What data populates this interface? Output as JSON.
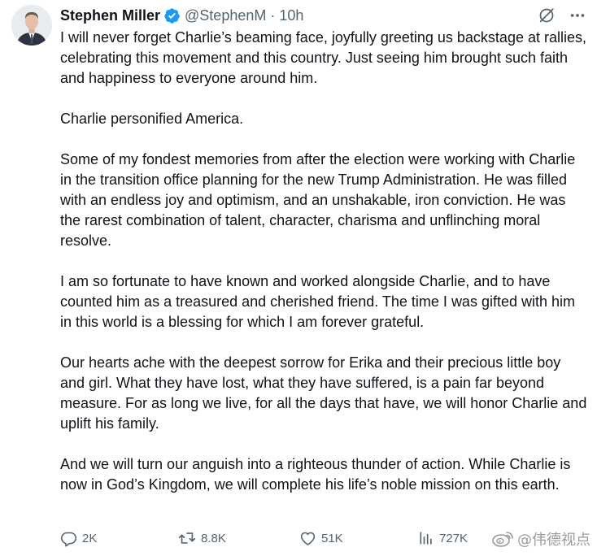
{
  "author": {
    "display_name": "Stephen Miller",
    "handle": "@StephenM",
    "separator": "·",
    "timestamp": "10h",
    "verified": true,
    "verified_color": "#1d9bf0"
  },
  "top_actions": {
    "grok_icon": "grok-icon",
    "more_icon": "more-horizontal-icon"
  },
  "paragraphs": [
    "I will never forget Charlie’s beaming face, joyfully greeting us backstage at rallies, celebrating this movement and this country. Just seeing him brought such faith and happiness to everyone around him.",
    "Charlie personified America.",
    "Some of my fondest memories from after the election were working with Charlie in the transition office planning for the new Trump Administration. He was filled with an endless joy and optimism, and an unshakable, iron conviction. He was the rarest combination of talent, character, charisma and unflinching moral resolve.",
    "I am so fortunate to have known and worked alongside Charlie, and to have counted him as a treasured and cherished friend. The time I was gifted with him in this world is a blessing for which I am forever grateful.",
    "Our hearts ache with the deepest sorrow for Erika and their precious little boy and girl. What they have lost, what they have suffered, is a pain far beyond measure. For as long we live, for all the days that have, we will honor Charlie and uplift his family.",
    "And we will turn our anguish into a righteous thunder of action. While Charlie is now in God’s Kingdom, we will complete his life’s noble mission on this earth."
  ],
  "metrics": {
    "replies": "2K",
    "reposts": "8.8K",
    "likes": "51K",
    "views": "727K"
  },
  "watermark": {
    "text": "@伟德视点"
  },
  "colors": {
    "text": "#0f1419",
    "secondary": "#536471",
    "accent": "#1d9bf0"
  }
}
